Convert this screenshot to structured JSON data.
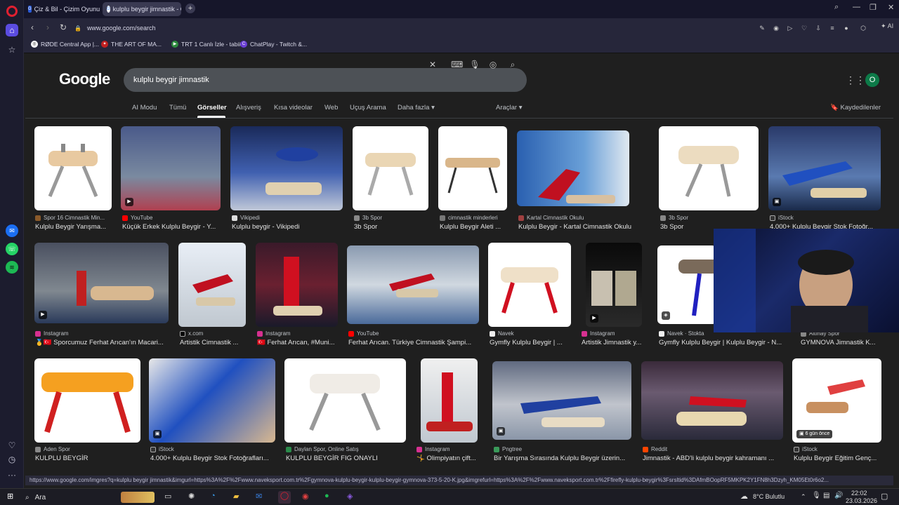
{
  "tabs": [
    {
      "title": "Çiz & Bil - Çizim Oyunu",
      "icon": "gartic-icon"
    },
    {
      "title": "kulplu beygir jimnastik - G",
      "icon": "google-icon"
    }
  ],
  "address": {
    "url": "www.google.com/search"
  },
  "bookmarks": [
    {
      "label": "RØDE Central App |..."
    },
    {
      "label": "THE ART OF MA..."
    },
    {
      "label": "TRT 1 Canlı İzle - tabii"
    },
    {
      "label": "ChatPlay - Twitch &..."
    }
  ],
  "addr_tools": {
    "ai_label": "AI"
  },
  "google": {
    "logo": "Google",
    "query": "kulplu beygir jimnastik",
    "avatar_letter": "O",
    "nav_tabs": [
      "AI Modu",
      "Tümü",
      "Görseller",
      "Alışveriş",
      "Kısa videolar",
      "Web",
      "Uçuş Arama",
      "Daha fazla"
    ],
    "active_tab": "Görseller",
    "tools_label": "Araçlar",
    "saved_label": "Kaydedilenler"
  },
  "results": [
    {
      "source": "Spor 16 Cimnastik Min...",
      "caption": "Kulplu Beygir Yarışma..."
    },
    {
      "source": "YouTube",
      "caption": "Küçük Erkek Kulplu Beygir - Y..."
    },
    {
      "source": "Vikipedi",
      "caption": "Kulplu beygir - Vikipedi"
    },
    {
      "source": "3b Spor",
      "caption": "3b Spor"
    },
    {
      "source": "cimnastik minderleri",
      "caption": "Kulplu Beygir Aleti ..."
    },
    {
      "source": "Kartal Cimnastik Okulu",
      "caption": "Kulplu Beygir - Kartal Cimnastik Okulu"
    },
    {
      "source": "3b Spor",
      "caption": "3b Spor"
    },
    {
      "source": "iStock",
      "caption": "4.000+ Kulplu Beygir Stok Fotoğr..."
    },
    {
      "source": "Instagram",
      "caption": "🥇🇹🇷 Sporcumuz Ferhat Arıcan'ın Macari..."
    },
    {
      "source": "x.com",
      "caption": "Artistik Cimnastik ..."
    },
    {
      "source": "Instagram",
      "caption": "🇹🇷 Ferhat Arıcan, #Muni..."
    },
    {
      "source": "YouTube",
      "caption": "Ferhat Arıcan. Türkiye Cimnastik Şampi..."
    },
    {
      "source": "Navek",
      "caption": "Gymfly Kulplu Beygir | ..."
    },
    {
      "source": "Instagram",
      "caption": "Artistik Jimnastik y..."
    },
    {
      "source": "Navek · Stokta",
      "caption": "Gymfly Kulplu Beygir | Kulplu Beygir - N..."
    },
    {
      "source": "Altınay Spor",
      "caption": "GYMNOVA Jimnastik K..."
    },
    {
      "source": "Aden Spor",
      "caption": "KULPLU BEYGİR"
    },
    {
      "source": "iStock",
      "caption": "4.000+ Kulplu Beygir Stok Fotoğrafları..."
    },
    {
      "source": "Daylan Spor, Online Satış",
      "caption": "KULPLU BEYGİR FIG ONAYLI"
    },
    {
      "source": "Instagram",
      "caption": "🤸 Olimpiyatın çift..."
    },
    {
      "source": "Pngtree",
      "caption": "Bir Yarışma Sırasında Kulplu Beygir üzerin..."
    },
    {
      "source": "Reddit",
      "caption": "Jimnastik - ABD'li kulplu beygir kahramanı ..."
    },
    {
      "source": "iStock",
      "caption": "Kulplu Beygir Eğitim Genç..."
    }
  ],
  "badges": {
    "days_ago": "6 gün önce"
  },
  "status_link": "https://www.google.com/imgres?q=kulplu beygir jimnastik&imgurl=https%3A%2F%2Fwww.naveksport.com.tr%2Fgymnova-kulplu-beygir-kulplu-beygir-gymnova-373-5-20-K.jpg&imgrefurl=https%3A%2F%2Fwww.naveksport.com.tr%2Ffirefly-kulplu-beygir%3Fsrsltid%3DAfmBOopRF5MKPK2Y1FN8h3Dzyh_KM05Et0r6o2...",
  "taskbar": {
    "search_placeholder": "Ara",
    "weather": "8°C  Bulutlu",
    "time": "22:02",
    "date": "23.03.2026"
  },
  "colors": {
    "accent": "#8ab4f8",
    "avatar": "#0d7a48",
    "opera_red": "#e02030"
  }
}
